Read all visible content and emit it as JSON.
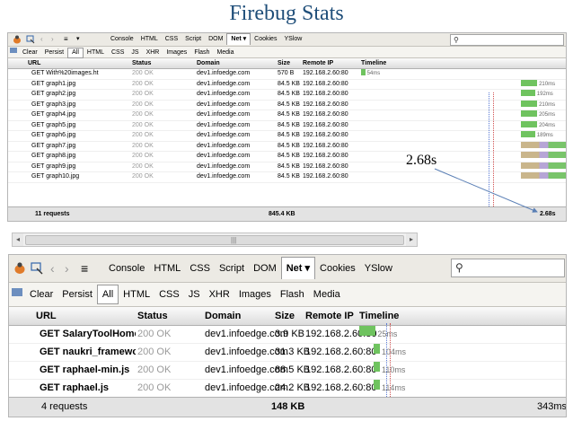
{
  "slide_title": "Firebug Stats",
  "callout": "2.68s",
  "colors": {
    "title": "#1f4e79",
    "bar_green": "#6fc35f",
    "bar_tan": "#c9b58b",
    "bar_purple": "#b6a5d6"
  },
  "toolbar": {
    "tabs": [
      "Console",
      "HTML",
      "CSS",
      "Script",
      "DOM",
      "Net ▾",
      "Cookies",
      "YSlow"
    ],
    "selected_tab": "Net ▾",
    "search_icon": "⚲"
  },
  "filters": {
    "items": [
      "Clear",
      "Persist",
      "All",
      "HTML",
      "CSS",
      "JS",
      "XHR",
      "Images",
      "Flash",
      "Media"
    ],
    "selected": "All"
  },
  "columns": [
    "URL",
    "Status",
    "Domain",
    "Size",
    "Remote IP",
    "Timeline"
  ],
  "panel1": {
    "rows": [
      {
        "url": "GET With%20images.ht",
        "status": "200 OK",
        "domain": "dev1.infoedge.com",
        "size": "570 B",
        "ip": "192.168.2.60:80",
        "time": "54ms",
        "start": 0.0,
        "dur": 0.02
      },
      {
        "url": "GET graph1.jpg",
        "status": "200 OK",
        "domain": "dev1.infoedge.com",
        "size": "84.5 KB",
        "ip": "192.168.2.60:80",
        "time": "210ms",
        "start": 0.78,
        "dur": 0.08
      },
      {
        "url": "GET graph2.jpg",
        "status": "200 OK",
        "domain": "dev1.infoedge.com",
        "size": "84.5 KB",
        "ip": "192.168.2.60:80",
        "time": "192ms",
        "start": 0.78,
        "dur": 0.07
      },
      {
        "url": "GET graph3.jpg",
        "status": "200 OK",
        "domain": "dev1.infoedge.com",
        "size": "84.5 KB",
        "ip": "192.168.2.60:80",
        "time": "210ms",
        "start": 0.78,
        "dur": 0.08
      },
      {
        "url": "GET graph4.jpg",
        "status": "200 OK",
        "domain": "dev1.infoedge.com",
        "size": "84.5 KB",
        "ip": "192.168.2.60:80",
        "time": "205ms",
        "start": 0.78,
        "dur": 0.08
      },
      {
        "url": "GET graph5.jpg",
        "status": "200 OK",
        "domain": "dev1.infoedge.com",
        "size": "84.5 KB",
        "ip": "192.168.2.60:80",
        "time": "204ms",
        "start": 0.78,
        "dur": 0.08
      },
      {
        "url": "GET graph6.jpg",
        "status": "200 OK",
        "domain": "dev1.infoedge.com",
        "size": "84.5 KB",
        "ip": "192.168.2.60:80",
        "time": "189ms",
        "start": 0.78,
        "dur": 0.07
      },
      {
        "url": "GET graph7.jpg",
        "status": "200 OK",
        "domain": "dev1.infoedge.com",
        "size": "84.5 KB",
        "ip": "192.168.2.60:80",
        "time": "",
        "start": 0.78,
        "dur": 0.3
      },
      {
        "url": "GET graph8.jpg",
        "status": "200 OK",
        "domain": "dev1.infoedge.com",
        "size": "84.5 KB",
        "ip": "192.168.2.60:80",
        "time": "",
        "start": 0.78,
        "dur": 0.3
      },
      {
        "url": "GET graph9.jpg",
        "status": "200 OK",
        "domain": "dev1.infoedge.com",
        "size": "84.5 KB",
        "ip": "192.168.2.60:80",
        "time": "",
        "start": 0.78,
        "dur": 0.3
      },
      {
        "url": "GET graph10.jpg",
        "status": "200 OK",
        "domain": "dev1.infoedge.com",
        "size": "84.5 KB",
        "ip": "192.168.2.60:80",
        "time": "",
        "start": 0.78,
        "dur": 0.3
      }
    ],
    "footer": {
      "count": "11 requests",
      "size": "845.4 KB",
      "time": "2.68s"
    }
  },
  "panel2": {
    "rows": [
      {
        "url": "GET SalaryToolHomePa",
        "status": "200 OK",
        "domain": "dev1.infoedge.com",
        "size": "3.9 KB",
        "ip": "192.168.2.60:80",
        "time": "25ms",
        "start": 0.0,
        "dur": 0.08
      },
      {
        "url": "GET naukri_framework_",
        "status": "200 OK",
        "domain": "dev1.infoedge.com",
        "size": "31.3 KB",
        "ip": "192.168.2.60:80",
        "time": "104ms",
        "start": 0.07,
        "dur": 0.03
      },
      {
        "url": "GET raphael-min.js",
        "status": "200 OK",
        "domain": "dev1.infoedge.com",
        "size": "88.5 KB",
        "ip": "192.168.2.60:80",
        "time": "110ms",
        "start": 0.07,
        "dur": 0.03
      },
      {
        "url": "GET raphael.js",
        "status": "200 OK",
        "domain": "dev1.infoedge.com",
        "size": "24.2 KB",
        "ip": "192.168.2.60:80",
        "time": "114ms",
        "start": 0.07,
        "dur": 0.03
      }
    ],
    "footer": {
      "count": "4 requests",
      "size": "148 KB",
      "time": "343ms"
    }
  },
  "scrollbar": {
    "left": "◂",
    "right": "▸",
    "grip": "|||"
  }
}
